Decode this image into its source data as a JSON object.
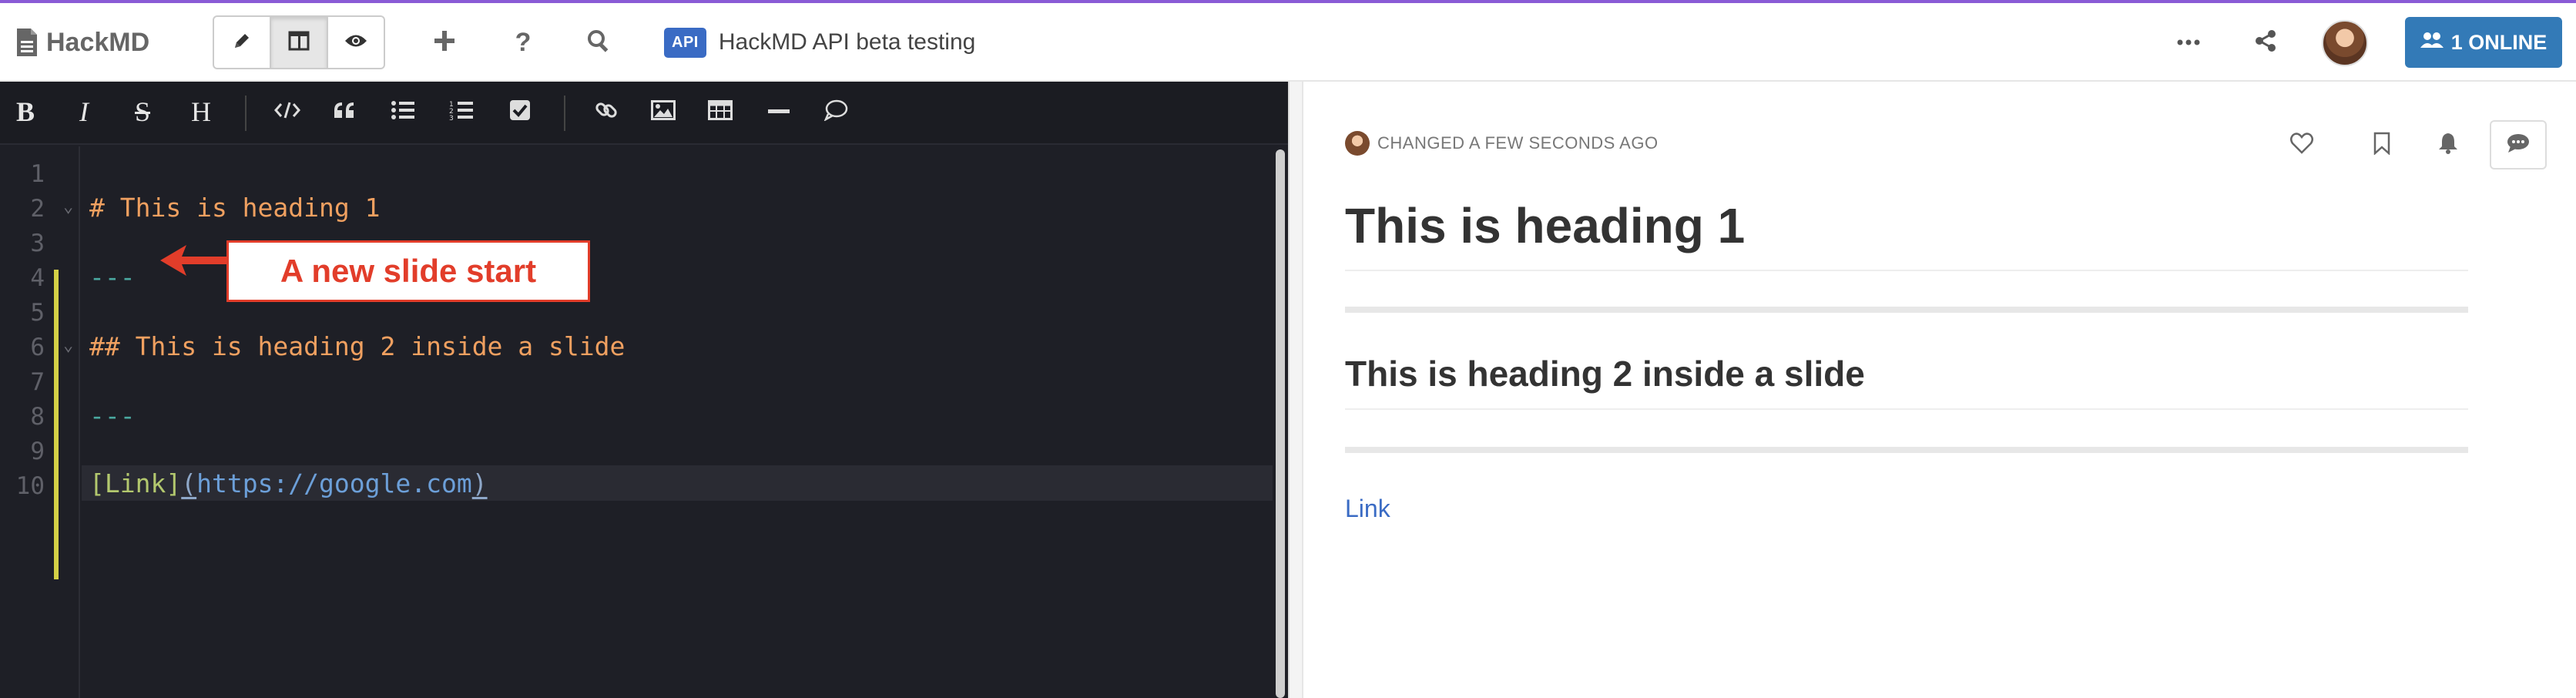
{
  "colors": {
    "accent_top": "#8a5bd6",
    "api_badge": "#3a6bc4",
    "online_button": "#337ab7",
    "callout": "#e23d2a",
    "editor_bg": "#1e1f26",
    "heading_syntax": "#f0a060",
    "hr_syntax": "#4aa8a0",
    "link_preview": "#3a6bc4"
  },
  "topbar": {
    "brand": "HackMD",
    "modes": [
      {
        "name": "edit",
        "icon": "pencil-icon"
      },
      {
        "name": "both",
        "icon": "columns-icon",
        "active": true
      },
      {
        "name": "view",
        "icon": "eye-icon"
      }
    ],
    "api_badge": "API",
    "doc_title": "HackMD API beta testing",
    "online_label": "1 ONLINE"
  },
  "editor": {
    "toolbar": {
      "bold": "B",
      "italic": "I",
      "strike": "S",
      "heading": "H"
    },
    "line_numbers": [
      "1",
      "2",
      "3",
      "4",
      "5",
      "6",
      "7",
      "8",
      "9",
      "10"
    ],
    "lines": {
      "l2": "# This is heading 1",
      "l4": "---",
      "l6": "## This is heading 2 inside a slide",
      "l8": "---",
      "l10_text": "[Link]",
      "l10_open": "(",
      "l10_url": "https://google.com",
      "l10_close": ")"
    },
    "callout": "A new slide start"
  },
  "preview": {
    "meta": "CHANGED A FEW SECONDS AGO",
    "h1": "This is heading 1",
    "h2": "This is heading 2 inside a slide",
    "link": "Link"
  }
}
